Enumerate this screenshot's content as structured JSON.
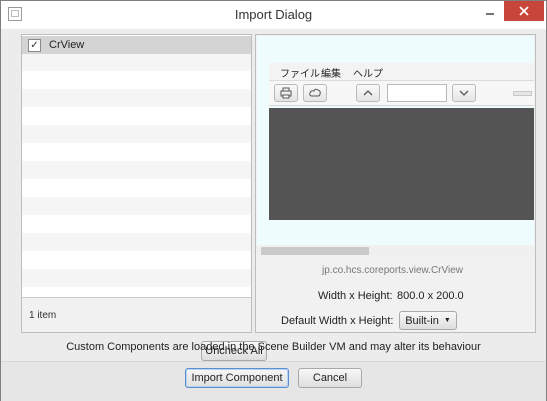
{
  "window": {
    "title": "Import Dialog"
  },
  "left_panel": {
    "items": [
      {
        "label": "CrView",
        "checked": true
      }
    ],
    "item_count": "1 item",
    "uncheck_all_label": "Uncheck All"
  },
  "preview": {
    "menus": [
      "ファイル",
      "編集",
      "ヘルプ"
    ],
    "class_name": "jp.co.hcs.coreports.view.CrView",
    "width_height_label": "Width x Height:",
    "width_height_value": "800.0 x 200.0",
    "default_wh_label": "Default Width x Height:",
    "default_wh_value": "Built-in"
  },
  "notice": "Custom Components are loaded in the Scene Builder VM and may alter its behaviour",
  "footer": {
    "import_label": "Import Component",
    "cancel_label": "Cancel"
  },
  "colors": {
    "close_button": "#c7453a",
    "preview_background": "#effcfd",
    "canvas": "#545454",
    "default_button_border": "#5a8ed0"
  }
}
